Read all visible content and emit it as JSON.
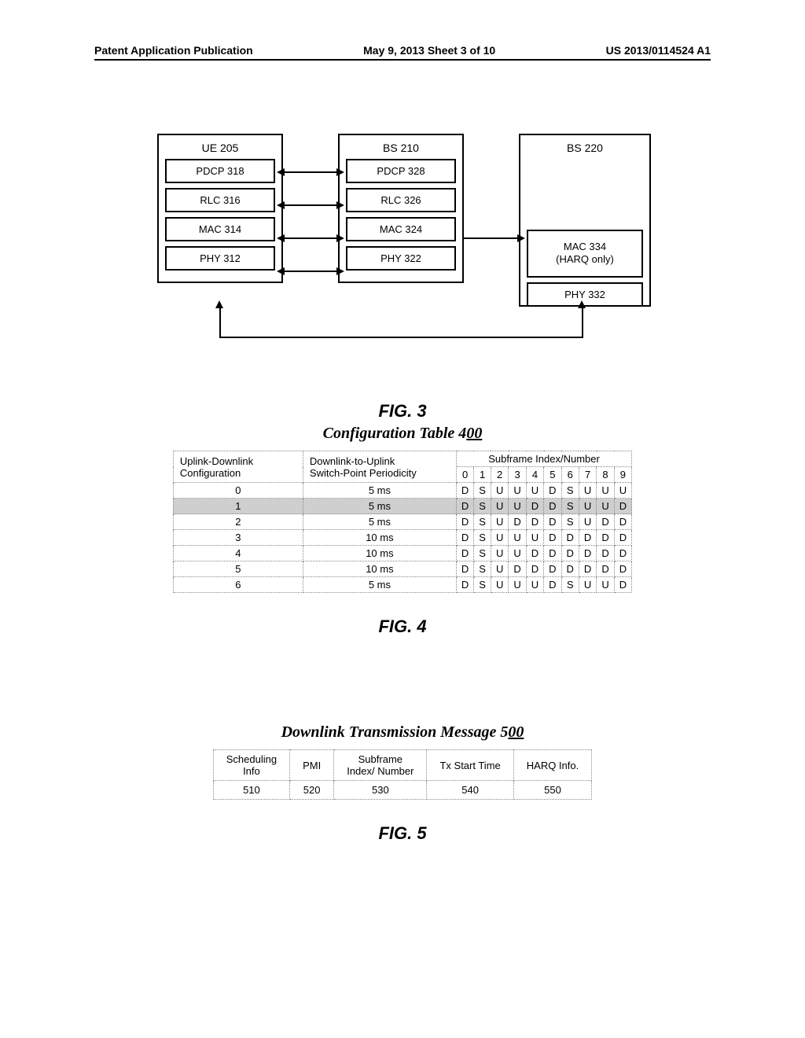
{
  "header": {
    "left": "Patent Application Publication",
    "middle": "May 9, 2013  Sheet 3 of 10",
    "right": "US 2013/0114524 A1"
  },
  "fig3": {
    "label": "FIG.  3",
    "ue": {
      "title": "UE 205",
      "pdcp": "PDCP 318",
      "rlc": "RLC 316",
      "mac": "MAC 314",
      "phy": "PHY 312"
    },
    "bs210": {
      "title": "BS 210",
      "pdcp": "PDCP 328",
      "rlc": "RLC 326",
      "mac": "MAC 324",
      "phy": "PHY 322"
    },
    "bs220": {
      "title": "BS 220",
      "mac": "MAC 334\n(HARQ only)",
      "phy": "PHY 332"
    }
  },
  "fig4": {
    "title_pre": "Configuration Table 4",
    "title_uline": "00",
    "label": "FIG.  4",
    "head_col1": "Uplink-Downlink\nConfiguration",
    "head_col2": "Downlink-to-Uplink\nSwitch-Point Periodicity",
    "head_merge": "Subframe Index/Number",
    "subidx": [
      "0",
      "1",
      "2",
      "3",
      "4",
      "5",
      "6",
      "7",
      "8",
      "9"
    ],
    "rows": [
      {
        "cfg": "0",
        "per": "5 ms",
        "cells": [
          "D",
          "S",
          "U",
          "U",
          "U",
          "D",
          "S",
          "U",
          "U",
          "U"
        ],
        "hl": false
      },
      {
        "cfg": "1",
        "per": "5 ms",
        "cells": [
          "D",
          "S",
          "U",
          "U",
          "D",
          "D",
          "S",
          "U",
          "U",
          "D"
        ],
        "hl": true
      },
      {
        "cfg": "2",
        "per": "5 ms",
        "cells": [
          "D",
          "S",
          "U",
          "D",
          "D",
          "D",
          "S",
          "U",
          "D",
          "D"
        ],
        "hl": false
      },
      {
        "cfg": "3",
        "per": "10 ms",
        "cells": [
          "D",
          "S",
          "U",
          "U",
          "U",
          "D",
          "D",
          "D",
          "D",
          "D"
        ],
        "hl": false
      },
      {
        "cfg": "4",
        "per": "10 ms",
        "cells": [
          "D",
          "S",
          "U",
          "U",
          "D",
          "D",
          "D",
          "D",
          "D",
          "D"
        ],
        "hl": false
      },
      {
        "cfg": "5",
        "per": "10 ms",
        "cells": [
          "D",
          "S",
          "U",
          "D",
          "D",
          "D",
          "D",
          "D",
          "D",
          "D"
        ],
        "hl": false
      },
      {
        "cfg": "6",
        "per": "5 ms",
        "cells": [
          "D",
          "S",
          "U",
          "U",
          "U",
          "D",
          "S",
          "U",
          "U",
          "D"
        ],
        "hl": false
      }
    ]
  },
  "fig5": {
    "title_pre": "Downlink Transmission Message 5",
    "title_uline": "00",
    "label": "FIG.  5",
    "headers": [
      "Scheduling\nInfo",
      "PMI",
      "Subframe\nIndex/ Number",
      "Tx Start Time",
      "HARQ Info."
    ],
    "values": [
      "510",
      "520",
      "530",
      "540",
      "550"
    ]
  }
}
